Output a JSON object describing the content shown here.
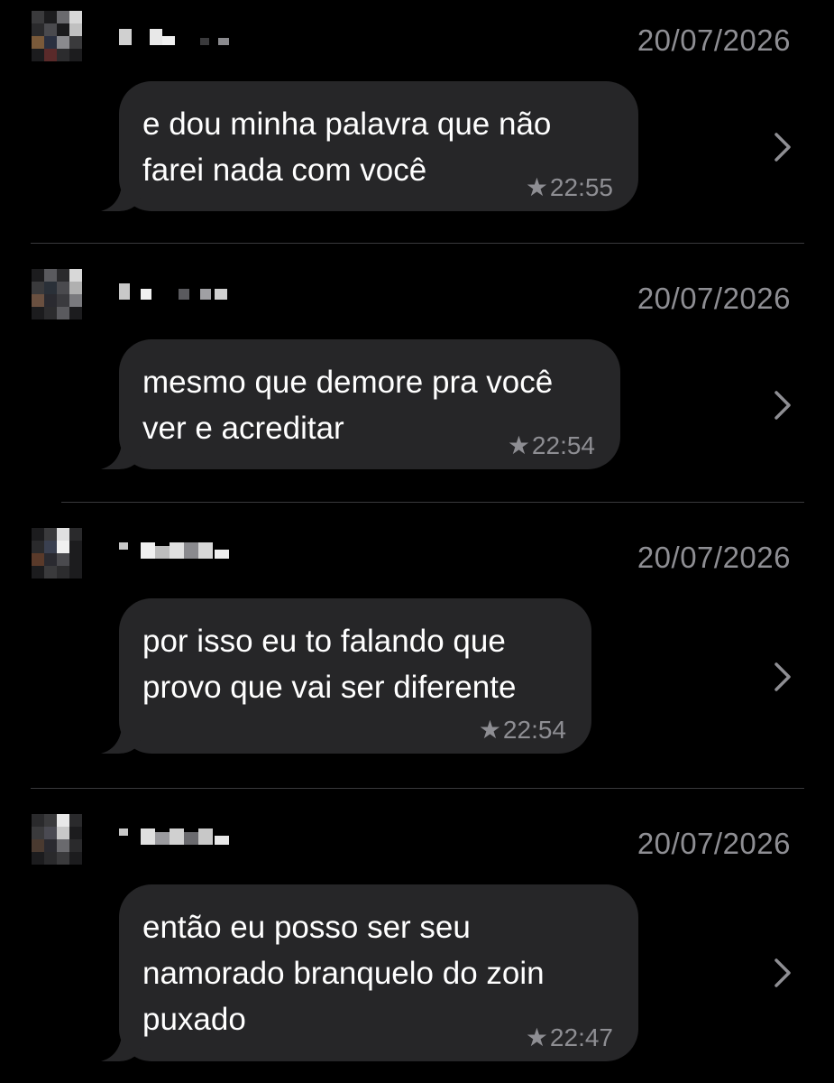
{
  "messages": [
    {
      "date": "20/07/2026",
      "text": "e dou minha palavra que não\nfarei nada com você",
      "time": "22:55"
    },
    {
      "date": "20/07/2026",
      "text": "mesmo que demore pra você\nver e acreditar",
      "time": "22:54"
    },
    {
      "date": "20/07/2026",
      "text": "por isso eu to falando que\nprovo que vai ser diferente",
      "time": "22:54"
    },
    {
      "date": "20/07/2026",
      "text": "então eu posso ser seu\nnamorado branquelo do zoin\npuxado",
      "time": "22:47"
    }
  ],
  "icons": {
    "star": "★",
    "chevron": "chevron-right-icon",
    "avatar": "pixelated-avatar-icon"
  },
  "colors": {
    "background": "#000000",
    "bubble": "#262628",
    "secondary_text": "#8e8e93",
    "divider": "#3a3a3c"
  }
}
